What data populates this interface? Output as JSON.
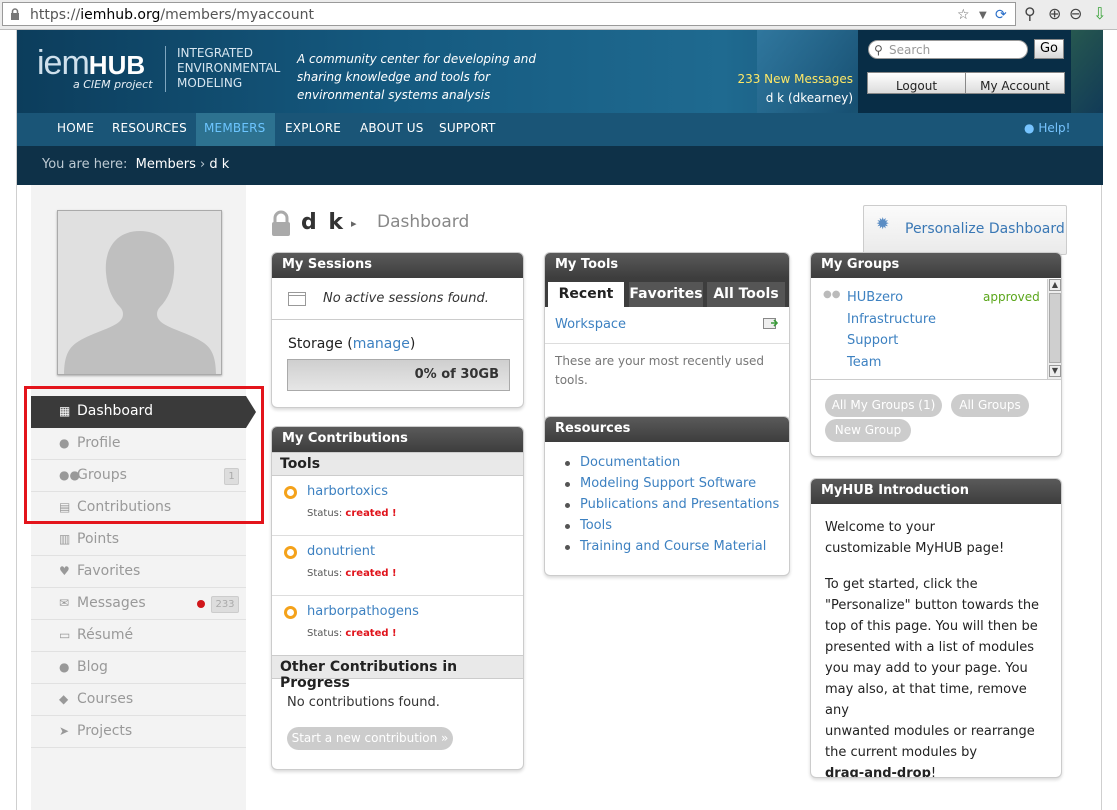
{
  "browser": {
    "url_prefix": "https://",
    "url_host": "iemhub.org",
    "url_path": "/members/myaccount"
  },
  "header": {
    "logo_iem": "iem",
    "logo_hub": "HUB",
    "logo_sub": "a CIEM project",
    "integrated_lines": [
      "INTEGRATED",
      "ENVIRONMENTAL",
      "MODELING"
    ],
    "tagline": "A community center for developing and sharing knowledge and tools for environmental systems analysis",
    "messages_link": "233 New Messages",
    "user_name": "d k (dkearney)",
    "search_placeholder": "Search",
    "go_label": "Go",
    "logout_label": "Logout",
    "myaccount_label": "My Account"
  },
  "nav": {
    "items": [
      {
        "label": "HOME"
      },
      {
        "label": "RESOURCES"
      },
      {
        "label": "MEMBERS"
      },
      {
        "label": "EXPLORE"
      },
      {
        "label": "ABOUT US"
      },
      {
        "label": "SUPPORT"
      }
    ],
    "active_index": 2,
    "help_label": "Help!"
  },
  "breadcrumb": {
    "prefix": "You are here:",
    "members": "Members",
    "separator": "›",
    "current": "d k"
  },
  "sidebar": {
    "items": [
      {
        "label": "Dashboard",
        "icon": "dashboard-icon"
      },
      {
        "label": "Profile",
        "icon": "user-icon"
      },
      {
        "label": "Groups",
        "icon": "groups-icon",
        "count": "1"
      },
      {
        "label": "Contributions",
        "icon": "book-icon"
      },
      {
        "label": "Points",
        "icon": "points-icon"
      },
      {
        "label": "Favorites",
        "icon": "heart-icon"
      },
      {
        "label": "Messages",
        "icon": "envelope-icon",
        "count": "233"
      },
      {
        "label": "Résumé",
        "icon": "resume-icon"
      },
      {
        "label": "Blog",
        "icon": "blog-icon"
      },
      {
        "label": "Courses",
        "icon": "mortarboard-icon"
      },
      {
        "label": "Projects",
        "icon": "send-icon"
      }
    ]
  },
  "page": {
    "user": "d k",
    "arrow": "▸",
    "title": "Dashboard",
    "personalize_label": "Personalize Dashboard"
  },
  "sessions": {
    "title": "My Sessions",
    "empty": "No active sessions found.",
    "storage_label": "Storage (",
    "manage_label": "manage",
    "storage_close": ")",
    "storage_value": "0% of 30GB",
    "storage_percent": 0
  },
  "contributions": {
    "title": "My Contributions",
    "tools_header": "Tools",
    "status_prefix": "Status:",
    "items": [
      {
        "name": "harbortoxics",
        "status": "created !"
      },
      {
        "name": "donutrient",
        "status": "created !"
      },
      {
        "name": "harborpathogens",
        "status": "created !"
      }
    ],
    "other_header": "Other Contributions in Progress",
    "none_found": "No contributions found.",
    "start_button": "Start a new contribution »"
  },
  "tools": {
    "title": "My Tools",
    "tabs": [
      "Recent",
      "Favorites",
      "All Tools"
    ],
    "workspace": "Workspace",
    "note": "These are your most recently used tools."
  },
  "resources": {
    "title": "Resources",
    "items": [
      "Documentation",
      "Modeling Support Software",
      "Publications and Presentations",
      "Tools",
      "Training and Course Material"
    ]
  },
  "groups": {
    "title": "My Groups",
    "group_lines": [
      "HUBzero",
      "Infrastructure",
      "Support",
      "Team"
    ],
    "group_status": "approved",
    "buttons": [
      "All My Groups (1)",
      "All Groups",
      "New Group"
    ]
  },
  "intro": {
    "title": "MyHUB Introduction",
    "para1": "Welcome to your customizable MyHUB page!",
    "para2_lines": [
      "To get started, click the",
      "\"Personalize\" button towards the",
      "top of this page. You will then be",
      "presented with a list of modules",
      "you may add to your page. You",
      "may also, at that time, remove any",
      "unwanted modules or rearrange",
      "the current modules by"
    ],
    "bold_end": "drag-and-drop",
    "end_mark": "!"
  },
  "colors": {
    "accent_link": "#3d81c1",
    "header_bg": "#155a80",
    "nav_active": "#6cc5ff",
    "status_red": "#e0131b",
    "approved_green": "#5aa61a",
    "highlight_red": "#e3141b"
  }
}
